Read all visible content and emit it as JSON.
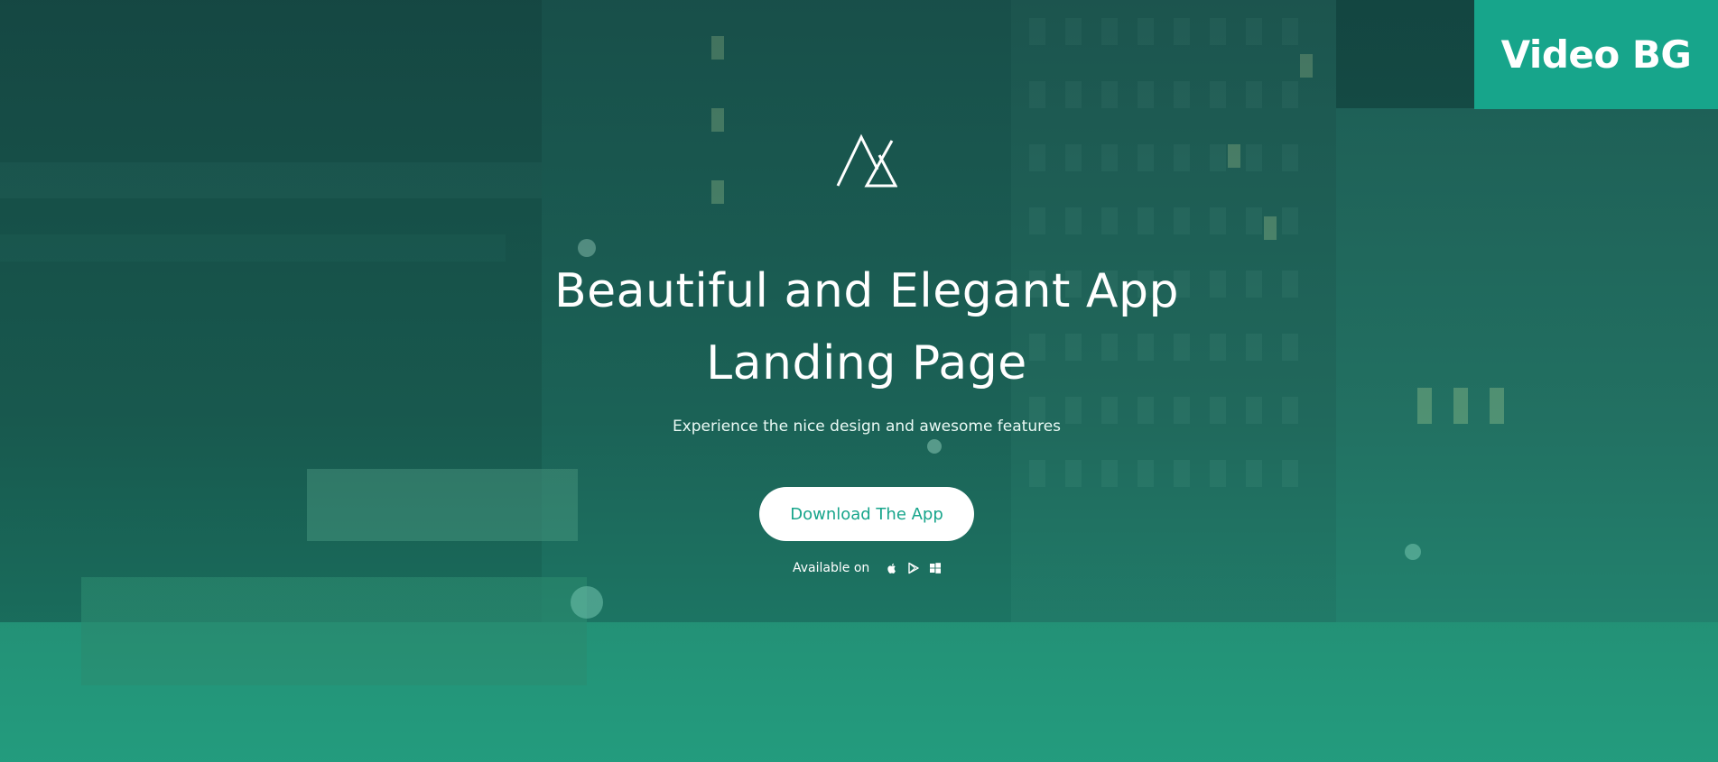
{
  "badge": {
    "label": "Video BG"
  },
  "hero": {
    "logo": "mountain-logo-icon",
    "headline_line1": "Beautiful and Elegant App",
    "headline_line2": "Landing Page",
    "subtitle": "Experience the nice design and awesome features",
    "cta_label": "Download The App",
    "available_label": "Available on",
    "platforms": [
      "apple-icon",
      "google-play-icon",
      "windows-icon"
    ]
  },
  "colors": {
    "accent": "#17a58b",
    "overlay_top": "#104e48",
    "overlay_bottom": "#1aaa87",
    "text": "#ffffff"
  }
}
